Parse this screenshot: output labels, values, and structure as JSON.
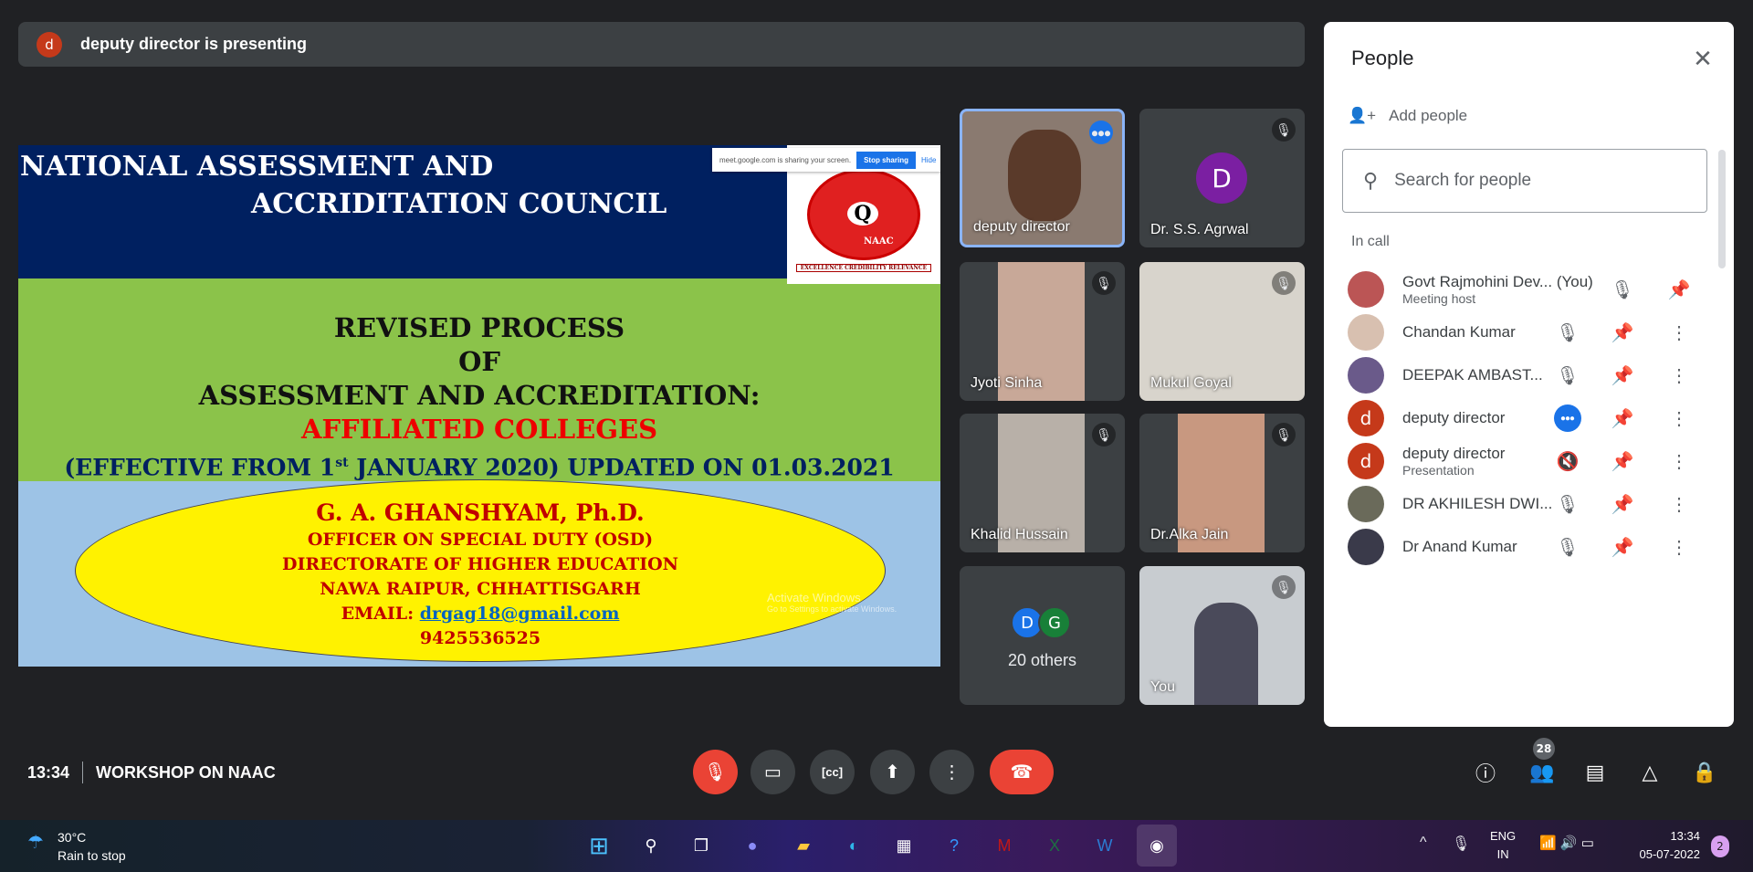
{
  "presenting": {
    "avatar": "d",
    "text": "deputy director is presenting"
  },
  "slide": {
    "title1": "NATIONAL ASSESSMENT AND",
    "title2": "ACCRIDITATION  COUNCIL",
    "share_notice": "meet.google.com is sharing your screen.",
    "stop_sharing": "Stop sharing",
    "hide": "Hide",
    "logo_text": "NAAC",
    "logo_motto": "EXCELLENCE CREDIBILITY RELEVANCE",
    "line1": "REVISED PROCESS",
    "line2": "OF",
    "line3": "ASSESSMENT AND ACCREDITATION:",
    "line4": "AFFILIATED COLLEGES",
    "line5a": "(EFFECTIVE FROM 1",
    "line5sup": "st",
    "line5b": " JANUARY 2020) UPDATED ON 01.03.2021",
    "name": "G. A. GHANSHYAM, Ph.D.",
    "role": "OFFICER ON SPECIAL DUTY (OSD)",
    "dept": "DIRECTORATE OF HIGHER EDUCATION",
    "place": "NAWA RAIPUR, CHHATTISGARH",
    "email_label": "EMAIL: ",
    "email": "drgag18@gmail.com",
    "phone": "9425536525",
    "watermark1": "Activate Windows",
    "watermark2": "Go to Settings to activate Windows."
  },
  "tiles": [
    {
      "name": "deputy director",
      "status": "speaking"
    },
    {
      "name": "Dr. S.S. Agrwal",
      "avatar": "D",
      "status": "muted"
    },
    {
      "name": "Jyoti Sinha",
      "status": "muted"
    },
    {
      "name": "Mukul Goyal",
      "status": "muted"
    },
    {
      "name": "Khalid Hussain",
      "status": "muted"
    },
    {
      "name": "Dr.Alka Jain",
      "status": "muted"
    },
    {
      "name": "20 others",
      "avatars": [
        "D",
        "G"
      ]
    },
    {
      "name": "You",
      "status": "muted"
    }
  ],
  "people": {
    "title": "People",
    "add": "Add people",
    "search_placeholder": "Search for people",
    "section": "In call",
    "list": [
      {
        "name": "Govt Rajmohini Dev...",
        "you": "(You)",
        "sub": "Meeting host"
      },
      {
        "name": "Chandan Kumar"
      },
      {
        "name": "DEEPAK AMBAST..."
      },
      {
        "name": "deputy director",
        "avatar": "d",
        "speaking": true
      },
      {
        "name": "deputy director",
        "avatar": "d",
        "sub": "Presentation"
      },
      {
        "name": "DR AKHILESH DWI..."
      },
      {
        "name": "Dr Anand Kumar"
      }
    ]
  },
  "bottom": {
    "time": "13:34",
    "meeting": "WORKSHOP ON NAAC",
    "people_count": "28"
  },
  "taskbar": {
    "temp": "30°C",
    "weather": "Rain to stop",
    "lang1": "ENG",
    "lang2": "IN",
    "time": "13:34",
    "date": "05-07-2022",
    "notif": "2"
  },
  "colors": {
    "accent": "#1a73e8",
    "hangup": "#ea4335",
    "avatar_d": "#c5391a"
  }
}
